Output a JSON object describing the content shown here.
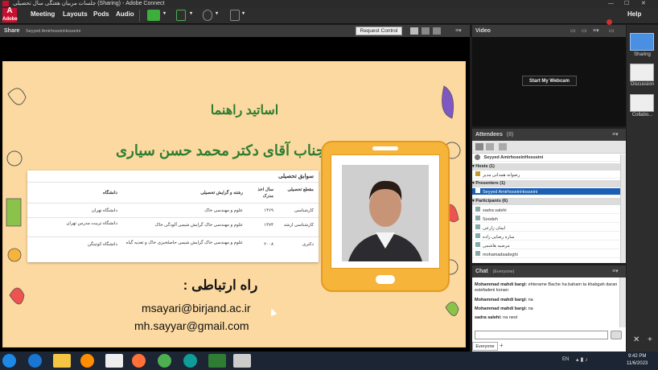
{
  "window": {
    "title": "جلسات مربیان هفتگی سال تحصیلی (Sharing) - Adobe Connect"
  },
  "menu": {
    "logo_text": "Adobe",
    "items": [
      "Meeting",
      "Layouts",
      "Pods",
      "Audio"
    ],
    "help": "Help"
  },
  "share_pod": {
    "label": "Share",
    "presenter": "Seyyed AmirhoseinHosseini",
    "request_control": "Request Control"
  },
  "slide": {
    "title": "اساتید راهنما",
    "name": "جناب آقای دکتر محمد حسن سیاری",
    "table": {
      "heading": "سوابق تحصیلی",
      "columns": [
        "مقطع تحصیلی",
        "سال اخذ مدرک",
        "رشته و گرایش تحصیلی",
        "دانشگاه"
      ],
      "rows": [
        [
          "کارشناسی",
          "۱۳۶۹",
          "علوم و مهندسی خاک",
          "دانشگاه تهران"
        ],
        [
          "کارشناسی ارشد",
          "۱۳۷۴",
          "علوم و مهندسی خاک گرایش شیمی آلودگی خاک",
          "دانشگاه تربیت مدرس تهران"
        ],
        [
          "دکتری",
          "۲۰۰۸",
          "علوم و مهندسی خاک گرایش شیمی حاصلخیزی خاک و تغذیه گیاه",
          "دانشگاه کوتینگن"
        ]
      ]
    },
    "contact_title": ": راه ارتباطی",
    "email_1": "msayari@birjand.ac.ir",
    "email_2": "mh.sayyar@gmail.com"
  },
  "video_pod": {
    "label": "Video",
    "webcam_button": "Start My Webcam"
  },
  "attendees_pod": {
    "label": "Attendees",
    "count": "(8)",
    "me": "Seyyed AmirhoseinHosseini",
    "groups": [
      {
        "label": "Hosts (1)",
        "members": [
          "رضوانه همدانی مدیر"
        ]
      },
      {
        "label": "Presenters (1)",
        "members": [
          "Seyyed AmirhoseinHosseini"
        ]
      },
      {
        "label": "Participants (6)",
        "members": [
          "sadra salehi",
          "Soodeh",
          "ایمان زارعی",
          "ساره رضایی زاده",
          "مرضیه هاشمی",
          "mohamadsadeghi"
        ]
      }
    ]
  },
  "chat_pod": {
    "label": "Chat",
    "scope": "(Everyone)",
    "messages": [
      {
        "sender": "Mohammad mahdi bargi:",
        "text": "ehterame Bache ha baham ta khabgah daran estefadeni konan"
      },
      {
        "sender": "Mohammad mahdi bargi:",
        "text": "na"
      },
      {
        "sender": "Mohammad mahdi bargi:",
        "text": "na"
      },
      {
        "sender": "sadra salehi:",
        "text": "na nest"
      }
    ],
    "tab": "Everyone"
  },
  "right_rail": {
    "items": [
      "Sharing",
      "Discussion",
      "Collabo..."
    ]
  },
  "taskbar": {
    "lang": "EN",
    "time": "9:42 PM",
    "date": "11/6/2023"
  },
  "colors": {
    "slide_bg": "#fcd9a0",
    "title_green": "#2e7d32",
    "selection_blue": "#1a5fb4"
  }
}
